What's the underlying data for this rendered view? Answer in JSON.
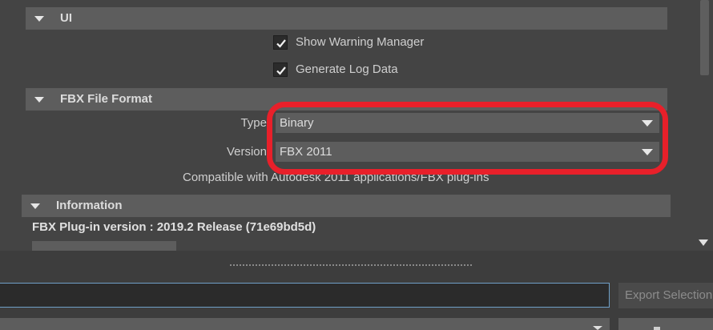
{
  "sections": {
    "ui": {
      "title": "UI"
    },
    "fbx_file_format": {
      "title": "FBX File Format"
    },
    "information": {
      "title": "Information"
    }
  },
  "ui_options": {
    "show_warning_manager": {
      "label": "Show Warning Manager",
      "checked": true
    },
    "generate_log_data": {
      "label": "Generate Log Data",
      "checked": true
    }
  },
  "file_format": {
    "type_label": "Type",
    "type_value": "Binary",
    "version_label": "Version",
    "version_value": "FBX 2011",
    "compat_text": "Compatible with Autodesk 2011 applications/FBX plug-ins"
  },
  "information": {
    "plugin_version": "FBX Plug-in version :  2019.2 Release (71e69bd5d)"
  },
  "bottom": {
    "export_button": "Export Selection"
  },
  "colors": {
    "highlight": "#e8202a",
    "section_header": "#5d5d5d",
    "background": "#444444"
  }
}
